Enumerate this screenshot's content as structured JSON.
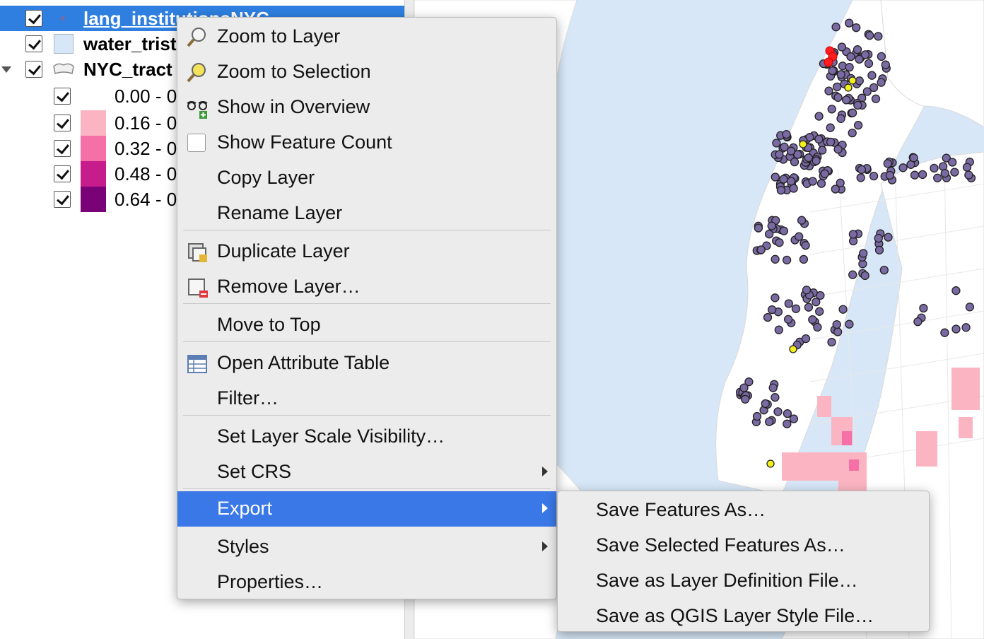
{
  "layers": {
    "items": [
      {
        "name": "lang_institutionsNYC",
        "checked": true,
        "selected": true
      },
      {
        "name": "water_trist",
        "checked": true
      },
      {
        "name": "NYC_tract",
        "checked": true,
        "expanded": true
      }
    ],
    "legend": [
      {
        "label": "0.00 - 0",
        "color": "#ffffff"
      },
      {
        "label": "0.16 - 0",
        "color": "#fbb5c2"
      },
      {
        "label": "0.32 - 0",
        "color": "#f570a6"
      },
      {
        "label": "0.48 - 0",
        "color": "#c71c8b"
      },
      {
        "label": "0.64 - 0",
        "color": "#7a0277"
      }
    ]
  },
  "context_menu": {
    "items": [
      {
        "label": "Zoom to Layer",
        "icon": "zoom-layer-icon"
      },
      {
        "label": "Zoom to Selection",
        "icon": "zoom-selection-icon"
      },
      {
        "label": "Show in Overview",
        "icon": "overview-glasses-icon"
      },
      {
        "label": "Show Feature Count",
        "icon": "checkbox-icon"
      },
      {
        "label": "Copy Layer"
      },
      {
        "label": "Rename Layer"
      },
      {
        "label": "Duplicate Layer",
        "icon": "duplicate-layer-icon"
      },
      {
        "label": "Remove Layer…",
        "icon": "remove-layer-icon"
      },
      {
        "label": "Move to Top"
      },
      {
        "label": "Open Attribute Table",
        "icon": "table-icon"
      },
      {
        "label": "Filter…"
      },
      {
        "label": "Set Layer Scale Visibility…"
      },
      {
        "label": "Set CRS",
        "submenu": true
      },
      {
        "label": "Export",
        "submenu": true,
        "highlighted": true
      },
      {
        "label": "Styles",
        "submenu": true
      },
      {
        "label": "Properties…"
      }
    ]
  },
  "export_submenu": {
    "items": [
      {
        "label": "Save Features As…"
      },
      {
        "label": "Save Selected Features As…"
      },
      {
        "label": "Save as Layer Definition File…"
      },
      {
        "label": "Save as QGIS Layer Style File…"
      }
    ]
  },
  "colors": {
    "selection": "#2e7fe0",
    "menu_highlight": "#3b78e7",
    "water": "#d7e7f7",
    "point_fill": "#7a6aa3",
    "point_selected": "#ff1d1d",
    "point_yellow": "#f2ef1c"
  }
}
